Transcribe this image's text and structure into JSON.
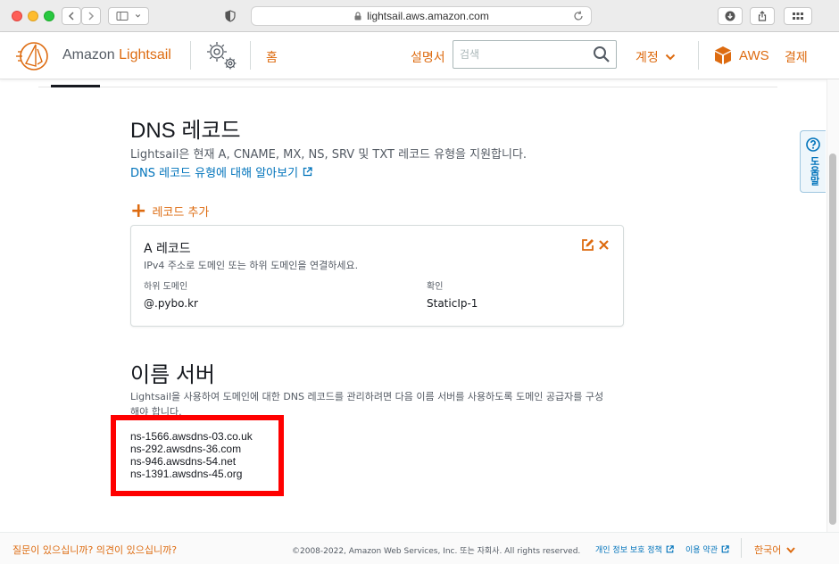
{
  "browser": {
    "url": "lightsail.aws.amazon.com"
  },
  "header": {
    "brand_prefix": "Amazon",
    "brand_name": "Lightsail",
    "home": "홈",
    "manual": "설명서",
    "search_placeholder": "검색",
    "account": "계정",
    "aws": "AWS",
    "billing": "결제"
  },
  "dns": {
    "title": "DNS 레코드",
    "description": "Lightsail은 현재 A, CNAME, MX, NS, SRV 및 TXT 레코드 유형을 지원합니다.",
    "learn_link": "DNS 레코드 유형에 대해 알아보기",
    "add_record": "레코드 추가",
    "record": {
      "title": "A 레코드",
      "description": "IPv4 주소로 도메인 또는 하위 도메인을 연결하세요.",
      "subdomain_label": "하위 도메인",
      "resolves_label": "확인",
      "subdomain_value": "@.pybo.kr",
      "resolves_value": "StaticIp-1"
    }
  },
  "nameservers": {
    "title": "이름 서버",
    "description": "Lightsail을 사용하여 도메인에 대한 DNS 레코드를 관리하려면 다음 이름 서버를 사용하도록 도메인 공급자를 구성해야 합니다.",
    "servers": [
      "ns-1566.awsdns-03.co.uk",
      "ns-292.awsdns-36.com",
      "ns-946.awsdns-54.net",
      "ns-1391.awsdns-45.org"
    ]
  },
  "help_tab": "도움말",
  "footer": {
    "feedback": "질문이 있으십니까? 의견이 있으십니까?",
    "copyright": "©2008-2022, Amazon Web Services, Inc. 또는 자회사. All rights reserved.",
    "privacy": "개인 정보 보호 정책",
    "terms": "이용 약관",
    "language": "한국어"
  },
  "colors": {
    "accent_orange": "#dd6b10",
    "link_blue": "#0073bb",
    "highlight_red": "#ff0000"
  }
}
